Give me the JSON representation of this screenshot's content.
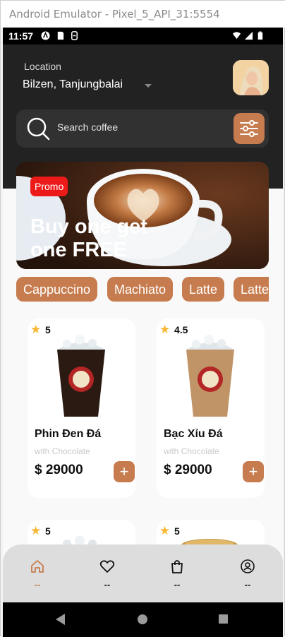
{
  "window": {
    "title": "Android Emulator - Pixel_5_API_31:5554"
  },
  "statusbar": {
    "time": "11:57"
  },
  "header": {
    "location_label": "Location",
    "location_value": "Bilzen, Tanjungbalai"
  },
  "search": {
    "placeholder": "Search coffee"
  },
  "promo": {
    "badge": "Promo",
    "title": "Buy one get one FREE"
  },
  "categories": [
    "Cappuccino",
    "Machiato",
    "Latte",
    "Latte"
  ],
  "products": [
    {
      "rating": "5",
      "name": "Phin Đen Đá",
      "subtitle": "with Chocolate",
      "price": "$ 29000",
      "add": "+",
      "cup_color": "#2b1a12"
    },
    {
      "rating": "4.5",
      "name": "Bạc Xỉu Đá",
      "subtitle": "with Chocolate",
      "price": "$ 29000",
      "add": "+",
      "cup_color": "#c09466"
    },
    {
      "rating": "5"
    },
    {
      "rating": "5"
    }
  ],
  "bottom_nav": {
    "items": [
      {
        "icon": "home-icon",
        "label": "--",
        "active": true
      },
      {
        "icon": "heart-icon",
        "label": "--"
      },
      {
        "icon": "bag-icon",
        "label": "--"
      },
      {
        "icon": "profile-icon",
        "label": "--"
      }
    ]
  },
  "colors": {
    "accent": "#c67c4e",
    "header_bg": "#222222",
    "promo_badge": "#ed1a1a",
    "star": "#f7b733"
  }
}
